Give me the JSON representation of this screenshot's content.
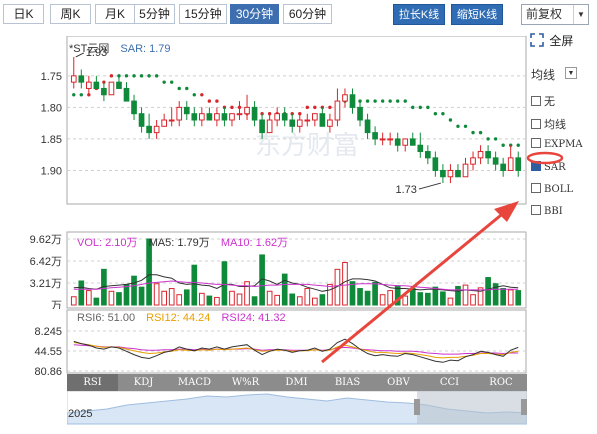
{
  "toolbar": {
    "periods": [
      "日K",
      "周K",
      "月K",
      "5分钟",
      "15分钟",
      "30分钟",
      "60分钟"
    ],
    "active_period": "30分钟",
    "stretch_button": "拉长K线",
    "shrink_button": "缩短K线",
    "adjust_select": "前复权"
  },
  "fullscreen_label": "全屏",
  "main": {
    "stock_name": "*ST云网",
    "sar_label": "SAR: 1.79",
    "y_ticks": [
      "1.90",
      "1.85",
      "1.80",
      "1.75"
    ],
    "high_annotation": "1.93",
    "low_annotation": "1.73",
    "watermark": "东方财富"
  },
  "side_panel": {
    "select_label": "均线",
    "options": [
      {
        "label": "无",
        "checked": false
      },
      {
        "label": "均线",
        "checked": false
      },
      {
        "label": "EXPMA",
        "checked": false
      },
      {
        "label": "SAR",
        "checked": true
      },
      {
        "label": "BOLL",
        "checked": false
      },
      {
        "label": "BBI",
        "checked": false
      }
    ]
  },
  "volume": {
    "vol_label": "VOL: 2.10万",
    "ma5_label": "MA5: 1.79万",
    "ma10_label": "MA10: 1.62万",
    "y_ticks": [
      "9.62万",
      "6.42万",
      "3.21万",
      "万"
    ]
  },
  "rsi": {
    "rsi6_label": "RSI6: 51.00",
    "rsi12_label": "RSI12: 44.24",
    "rsi24_label": "RSI24: 41.32",
    "y_ticks": [
      "80.86",
      "44.55",
      "8.245"
    ]
  },
  "indicator_tabs": [
    "RSI",
    "KDJ",
    "MACD",
    "W%R",
    "DMI",
    "BIAS",
    "OBV",
    "CCI",
    "ROC"
  ],
  "active_indicator": "RSI",
  "navigator": {
    "year": "2025"
  },
  "colors": {
    "up": "#d9262c",
    "down": "#0e8a3a",
    "sar_up": "#d9262c",
    "sar_down": "#0e8a3a",
    "active_tab": "#3d6fb0",
    "button": "#2f6cb3",
    "ma5": "#333333",
    "ma10": "#cc33cc",
    "rsi6": "#333333",
    "rsi12": "#e8a000",
    "rsi24": "#cc33cc",
    "annotation": "#e8453c"
  },
  "chart_data": {
    "type": "candlestick",
    "period": "30分钟",
    "indicator": "SAR",
    "yticks": [
      1.75,
      1.8,
      1.85,
      1.9
    ],
    "candles": [
      {
        "o": 1.89,
        "h": 1.93,
        "l": 1.88,
        "c": 1.9
      },
      {
        "o": 1.9,
        "h": 1.91,
        "l": 1.88,
        "c": 1.89
      },
      {
        "o": 1.88,
        "h": 1.9,
        "l": 1.87,
        "c": 1.89
      },
      {
        "o": 1.89,
        "h": 1.9,
        "l": 1.88,
        "c": 1.88
      },
      {
        "o": 1.88,
        "h": 1.89,
        "l": 1.86,
        "c": 1.87
      },
      {
        "o": 1.87,
        "h": 1.89,
        "l": 1.87,
        "c": 1.89
      },
      {
        "o": 1.89,
        "h": 1.9,
        "l": 1.88,
        "c": 1.88
      },
      {
        "o": 1.88,
        "h": 1.89,
        "l": 1.86,
        "c": 1.86
      },
      {
        "o": 1.86,
        "h": 1.87,
        "l": 1.83,
        "c": 1.84
      },
      {
        "o": 1.84,
        "h": 1.85,
        "l": 1.81,
        "c": 1.82
      },
      {
        "o": 1.82,
        "h": 1.84,
        "l": 1.8,
        "c": 1.81
      },
      {
        "o": 1.81,
        "h": 1.83,
        "l": 1.8,
        "c": 1.82
      },
      {
        "o": 1.82,
        "h": 1.84,
        "l": 1.82,
        "c": 1.83
      },
      {
        "o": 1.83,
        "h": 1.85,
        "l": 1.82,
        "c": 1.83
      },
      {
        "o": 1.83,
        "h": 1.86,
        "l": 1.82,
        "c": 1.85
      },
      {
        "o": 1.85,
        "h": 1.86,
        "l": 1.83,
        "c": 1.84
      },
      {
        "o": 1.84,
        "h": 1.85,
        "l": 1.82,
        "c": 1.83
      },
      {
        "o": 1.83,
        "h": 1.85,
        "l": 1.82,
        "c": 1.84
      },
      {
        "o": 1.84,
        "h": 1.85,
        "l": 1.83,
        "c": 1.83
      },
      {
        "o": 1.83,
        "h": 1.85,
        "l": 1.82,
        "c": 1.84
      },
      {
        "o": 1.84,
        "h": 1.85,
        "l": 1.82,
        "c": 1.83
      },
      {
        "o": 1.83,
        "h": 1.84,
        "l": 1.82,
        "c": 1.84
      },
      {
        "o": 1.84,
        "h": 1.86,
        "l": 1.83,
        "c": 1.84
      },
      {
        "o": 1.84,
        "h": 1.87,
        "l": 1.83,
        "c": 1.85
      },
      {
        "o": 1.85,
        "h": 1.86,
        "l": 1.82,
        "c": 1.83
      },
      {
        "o": 1.83,
        "h": 1.84,
        "l": 1.8,
        "c": 1.81
      },
      {
        "o": 1.81,
        "h": 1.84,
        "l": 1.81,
        "c": 1.83
      },
      {
        "o": 1.83,
        "h": 1.85,
        "l": 1.82,
        "c": 1.84
      },
      {
        "o": 1.84,
        "h": 1.85,
        "l": 1.82,
        "c": 1.83
      },
      {
        "o": 1.83,
        "h": 1.84,
        "l": 1.81,
        "c": 1.82
      },
      {
        "o": 1.82,
        "h": 1.84,
        "l": 1.81,
        "c": 1.83
      },
      {
        "o": 1.83,
        "h": 1.84,
        "l": 1.82,
        "c": 1.83
      },
      {
        "o": 1.83,
        "h": 1.84,
        "l": 1.82,
        "c": 1.84
      },
      {
        "o": 1.84,
        "h": 1.85,
        "l": 1.82,
        "c": 1.82
      },
      {
        "o": 1.82,
        "h": 1.84,
        "l": 1.81,
        "c": 1.83
      },
      {
        "o": 1.83,
        "h": 1.88,
        "l": 1.82,
        "c": 1.86
      },
      {
        "o": 1.86,
        "h": 1.88,
        "l": 1.85,
        "c": 1.87
      },
      {
        "o": 1.87,
        "h": 1.88,
        "l": 1.84,
        "c": 1.85
      },
      {
        "o": 1.85,
        "h": 1.86,
        "l": 1.82,
        "c": 1.83
      },
      {
        "o": 1.83,
        "h": 1.84,
        "l": 1.8,
        "c": 1.81
      },
      {
        "o": 1.81,
        "h": 1.82,
        "l": 1.79,
        "c": 1.8
      },
      {
        "o": 1.8,
        "h": 1.81,
        "l": 1.79,
        "c": 1.8
      },
      {
        "o": 1.8,
        "h": 1.81,
        "l": 1.79,
        "c": 1.8
      },
      {
        "o": 1.8,
        "h": 1.81,
        "l": 1.78,
        "c": 1.79
      },
      {
        "o": 1.79,
        "h": 1.8,
        "l": 1.78,
        "c": 1.8
      },
      {
        "o": 1.8,
        "h": 1.81,
        "l": 1.79,
        "c": 1.79
      },
      {
        "o": 1.79,
        "h": 1.81,
        "l": 1.77,
        "c": 1.78
      },
      {
        "o": 1.78,
        "h": 1.79,
        "l": 1.76,
        "c": 1.77
      },
      {
        "o": 1.77,
        "h": 1.78,
        "l": 1.74,
        "c": 1.75
      },
      {
        "o": 1.75,
        "h": 1.76,
        "l": 1.73,
        "c": 1.74
      },
      {
        "o": 1.74,
        "h": 1.76,
        "l": 1.73,
        "c": 1.75
      },
      {
        "o": 1.75,
        "h": 1.76,
        "l": 1.74,
        "c": 1.74
      },
      {
        "o": 1.74,
        "h": 1.77,
        "l": 1.74,
        "c": 1.76
      },
      {
        "o": 1.76,
        "h": 1.78,
        "l": 1.75,
        "c": 1.77
      },
      {
        "o": 1.77,
        "h": 1.79,
        "l": 1.76,
        "c": 1.78
      },
      {
        "o": 1.78,
        "h": 1.79,
        "l": 1.76,
        "c": 1.77
      },
      {
        "o": 1.77,
        "h": 1.78,
        "l": 1.75,
        "c": 1.76
      },
      {
        "o": 1.76,
        "h": 1.77,
        "l": 1.74,
        "c": 1.75
      },
      {
        "o": 1.75,
        "h": 1.79,
        "l": 1.75,
        "c": 1.77
      },
      {
        "o": 1.77,
        "h": 1.78,
        "l": 1.74,
        "c": 1.75
      }
    ],
    "sar": [
      1.87,
      1.87,
      1.87,
      1.88,
      1.89,
      1.9,
      1.9,
      1.9,
      1.9,
      1.9,
      1.9,
      1.9,
      1.89,
      1.89,
      1.88,
      1.88,
      1.87,
      1.87,
      1.86,
      1.86,
      1.85,
      1.85,
      1.85,
      1.84,
      1.84,
      1.84,
      1.84,
      1.84,
      1.84,
      1.84,
      1.84,
      1.85,
      1.85,
      1.85,
      1.85,
      1.85,
      1.86,
      1.86,
      1.86,
      1.86,
      1.86,
      1.86,
      1.86,
      1.86,
      1.86,
      1.85,
      1.85,
      1.85,
      1.84,
      1.84,
      1.83,
      1.82,
      1.82,
      1.81,
      1.81,
      1.8,
      1.8,
      1.79,
      1.79,
      1.79
    ],
    "sar_up_indices": [
      2,
      3,
      4,
      5,
      17,
      18,
      19,
      20,
      21,
      22,
      23,
      24,
      25,
      26,
      27,
      28,
      29,
      30,
      31,
      32,
      33,
      34
    ],
    "volume": [
      1.2,
      3.5,
      2.1,
      1.0,
      5.2,
      2.0,
      1.8,
      3.0,
      4.2,
      2.6,
      9.62,
      3.1,
      2.0,
      2.4,
      1.5,
      2.2,
      5.8,
      1.7,
      1.3,
      1.1,
      6.3,
      2.0,
      1.6,
      3.4,
      1.2,
      7.3,
      2.0,
      1.4,
      4.5,
      1.6,
      1.2,
      2.4,
      1.0,
      1.5,
      3.0,
      5.2,
      6.2,
      3.4,
      2.4,
      2.0,
      3.3,
      1.5,
      2.1,
      2.8,
      1.3,
      2.4,
      1.8,
      1.7,
      2.6,
      1.9,
      1.0,
      2.7,
      2.9,
      1.5,
      2.5,
      4.0,
      3.1,
      2.4,
      2.2,
      2.1
    ],
    "ma5": [
      2.5,
      2.6,
      2.4,
      2.3,
      2.7,
      2.8,
      2.9,
      3.0,
      3.2,
      3.6,
      4.4,
      4.4,
      4.1,
      3.9,
      3.2,
      3.0,
      3.1,
      2.9,
      2.8,
      2.4,
      3.0,
      3.0,
      2.7,
      2.7,
      2.8,
      3.8,
      3.5,
      3.0,
      3.6,
      3.2,
      3.0,
      2.6,
      2.3,
      2.0,
      2.2,
      2.7,
      3.4,
      3.8,
      3.8,
      3.7,
      3.5,
      3.0,
      2.5,
      2.4,
      2.4,
      2.3,
      2.2,
      2.3,
      2.3,
      2.2,
      2.1,
      2.0,
      2.2,
      2.1,
      2.0,
      2.3,
      2.6,
      2.8,
      2.6,
      2.5
    ],
    "ma10": [
      2.3,
      2.3,
      2.3,
      2.3,
      2.4,
      2.5,
      2.6,
      2.7,
      2.8,
      3.0,
      3.2,
      3.3,
      3.4,
      3.5,
      3.4,
      3.3,
      3.3,
      3.2,
      3.1,
      3.0,
      3.0,
      2.9,
      2.8,
      2.8,
      2.7,
      2.8,
      2.9,
      2.9,
      3.0,
      3.0,
      3.0,
      3.0,
      2.9,
      2.8,
      2.7,
      2.8,
      2.9,
      3.0,
      3.1,
      3.1,
      3.1,
      3.0,
      2.9,
      2.8,
      2.8,
      2.7,
      2.6,
      2.5,
      2.4,
      2.3,
      2.2,
      2.2,
      2.2,
      2.2,
      2.2,
      2.2,
      2.3,
      2.3,
      2.3,
      2.3
    ],
    "rsi6": [
      62,
      58,
      55,
      50,
      48,
      52,
      50,
      44,
      38,
      33,
      31,
      36,
      42,
      45,
      52,
      48,
      45,
      50,
      48,
      52,
      48,
      52,
      54,
      56,
      46,
      38,
      44,
      48,
      46,
      42,
      45,
      46,
      50,
      44,
      48,
      60,
      66,
      58,
      48,
      40,
      36,
      38,
      36,
      35,
      40,
      38,
      34,
      30,
      26,
      24,
      28,
      27,
      34,
      38,
      44,
      42,
      38,
      35,
      46,
      51
    ],
    "rsi12": [
      60,
      58,
      56,
      53,
      51,
      52,
      51,
      48,
      45,
      42,
      40,
      41,
      43,
      44,
      47,
      46,
      45,
      47,
      46,
      48,
      47,
      48,
      49,
      50,
      47,
      44,
      45,
      46,
      46,
      44,
      45,
      45,
      47,
      45,
      46,
      52,
      55,
      52,
      48,
      45,
      42,
      42,
      41,
      40,
      41,
      40,
      38,
      36,
      33,
      32,
      33,
      33,
      35,
      37,
      40,
      40,
      39,
      38,
      42,
      44
    ],
    "rsi24": [
      56,
      55,
      54,
      53,
      52,
      52,
      52,
      50,
      49,
      47,
      46,
      46,
      47,
      47,
      48,
      48,
      47,
      48,
      47,
      48,
      48,
      48,
      48,
      49,
      48,
      46,
      47,
      47,
      47,
      46,
      46,
      46,
      47,
      46,
      47,
      50,
      51,
      50,
      48,
      47,
      46,
      45,
      45,
      44,
      44,
      44,
      43,
      41,
      40,
      39,
      39,
      39,
      40,
      40,
      41,
      41,
      41,
      40,
      41,
      41
    ],
    "rsi_yticks": [
      8.245,
      44.55,
      80.86
    ]
  }
}
